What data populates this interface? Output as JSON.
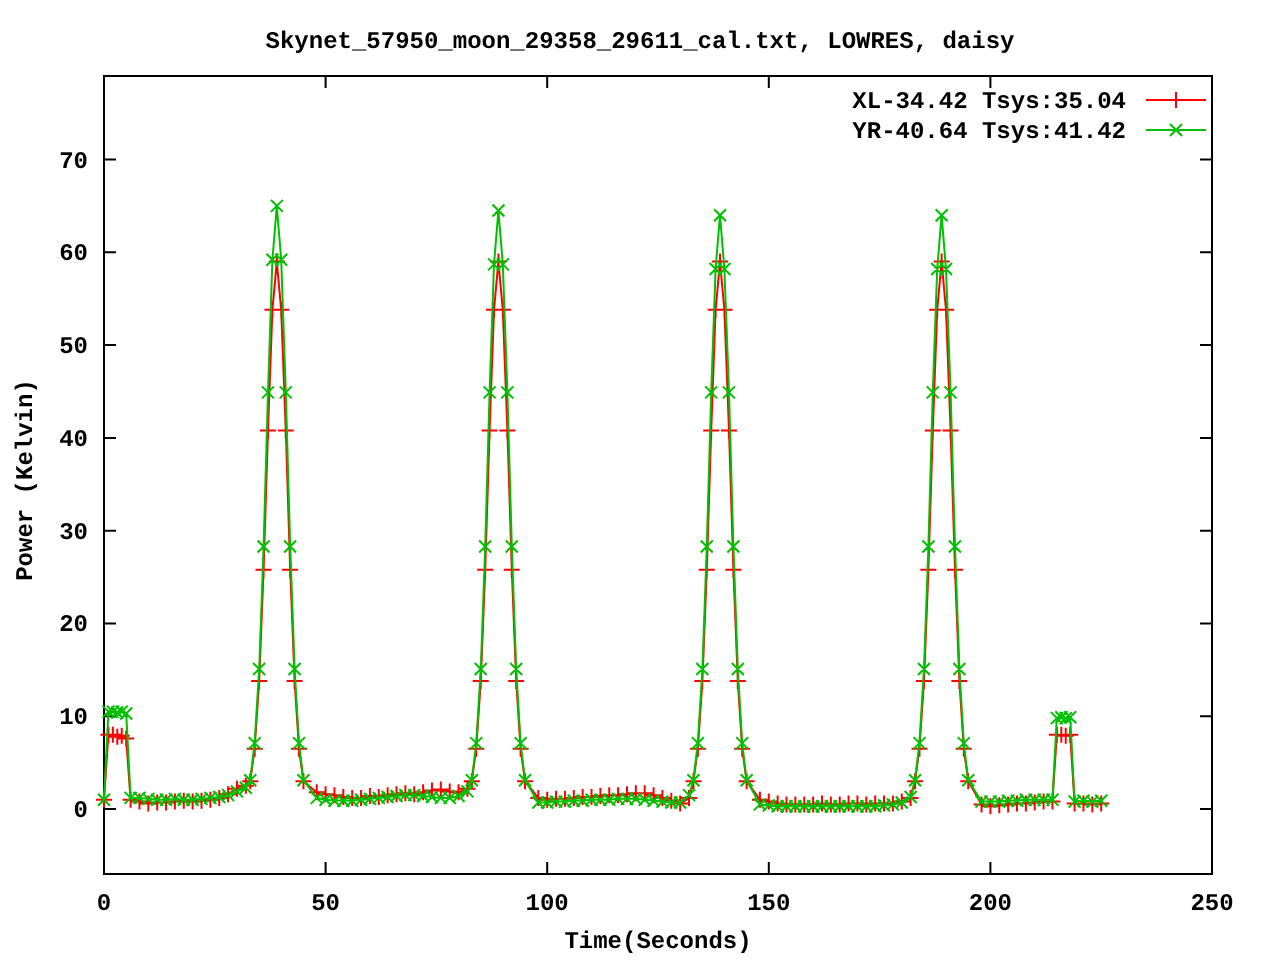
{
  "chart_data": {
    "type": "line",
    "title": "Skynet_57950_moon_29358_29611_cal.txt, LOWRES, daisy",
    "xlabel": "Time(Seconds)",
    "ylabel": "Power (Kelvin)",
    "xlim": [
      0,
      250
    ],
    "ylim": [
      -7,
      79
    ],
    "legend": true,
    "xticks": [
      0,
      50,
      100,
      150,
      200,
      250
    ],
    "yticks": [
      0,
      10,
      20,
      30,
      40,
      50,
      60,
      70
    ],
    "x": [
      0,
      1,
      2,
      3,
      4,
      5,
      6,
      8,
      10,
      12,
      14,
      16,
      18,
      20,
      22,
      24,
      26,
      28,
      30,
      32,
      33,
      34,
      35,
      36,
      37,
      38,
      39,
      40,
      41,
      42,
      43,
      44,
      45,
      48,
      50,
      52,
      54,
      56,
      58,
      60,
      62,
      64,
      66,
      68,
      70,
      72,
      74,
      76,
      78,
      80,
      82,
      83,
      84,
      85,
      86,
      87,
      88,
      89,
      90,
      91,
      92,
      93,
      94,
      95,
      98,
      100,
      102,
      104,
      106,
      108,
      110,
      112,
      114,
      116,
      118,
      120,
      122,
      124,
      126,
      128,
      130,
      132,
      133,
      134,
      135,
      136,
      137,
      138,
      139,
      140,
      141,
      142,
      143,
      144,
      145,
      148,
      150,
      152,
      154,
      156,
      158,
      160,
      162,
      164,
      166,
      168,
      170,
      172,
      174,
      176,
      178,
      180,
      182,
      183,
      184,
      185,
      186,
      187,
      188,
      189,
      190,
      191,
      192,
      193,
      194,
      195,
      198,
      200,
      202,
      204,
      206,
      208,
      210,
      212,
      214,
      215,
      216,
      217,
      218,
      219,
      221,
      223,
      225
    ],
    "series": [
      {
        "name": "XL-34.42 Tsys:35.04",
        "color": "#ff0000",
        "marker": "plus",
        "values": [
          1,
          8,
          8,
          7.8,
          7.9,
          7.6,
          1,
          0.8,
          0.6,
          0.7,
          0.7,
          0.8,
          0.9,
          0.8,
          0.9,
          1,
          1.2,
          1.6,
          2.2,
          2.5,
          3,
          6.5,
          13.8,
          25.8,
          40.8,
          53.8,
          59,
          53.8,
          40.8,
          25.8,
          13.8,
          6.5,
          3,
          1.8,
          1.6,
          1.5,
          1.3,
          1.2,
          1.2,
          1.4,
          1.3,
          1.5,
          1.6,
          1.7,
          1.6,
          1.8,
          2,
          2.1,
          1.9,
          1.8,
          2.2,
          3,
          6.5,
          13.8,
          25.8,
          40.8,
          53.8,
          59,
          53.8,
          40.8,
          25.8,
          13.8,
          6.5,
          3,
          1.2,
          1,
          1.1,
          1.1,
          1.2,
          1.3,
          1.3,
          1.4,
          1.5,
          1.5,
          1.6,
          1.7,
          1.7,
          1.5,
          1.2,
          0.9,
          0.6,
          1.2,
          3,
          6.5,
          13.8,
          25.8,
          40.8,
          53.8,
          59,
          53.8,
          40.8,
          25.8,
          13.8,
          6.5,
          3,
          1,
          0.8,
          0.6,
          0.5,
          0.5,
          0.5,
          0.5,
          0.6,
          0.5,
          0.5,
          0.6,
          0.6,
          0.5,
          0.6,
          0.6,
          0.6,
          0.8,
          1.2,
          3,
          6.5,
          13.8,
          25.8,
          40.8,
          53.8,
          59,
          53.8,
          40.8,
          25.8,
          13.8,
          6.5,
          3,
          0.5,
          0.3,
          0.4,
          0.5,
          0.6,
          0.6,
          0.7,
          0.8,
          0.8,
          8,
          8,
          7.9,
          8,
          0.6,
          0.6,
          0.5,
          0.6
        ]
      },
      {
        "name": "YR-40.64 Tsys:41.42",
        "color": "#00c000",
        "marker": "cross",
        "values": [
          1,
          10.5,
          10.5,
          10.4,
          10.5,
          10.3,
          1.2,
          1.2,
          1.1,
          1,
          1,
          1.1,
          1,
          1,
          1.1,
          1.2,
          1.3,
          1.5,
          1.9,
          2.3,
          3.1,
          7.1,
          15.1,
          28.3,
          44.9,
          59.2,
          65,
          59.2,
          44.9,
          28.3,
          15.1,
          7.1,
          3.1,
          1.2,
          1,
          0.9,
          0.9,
          0.9,
          1,
          1.1,
          1.2,
          1.3,
          1.4,
          1.5,
          1.5,
          1.4,
          1.3,
          1.2,
          1.2,
          1.4,
          1.9,
          3.1,
          7.1,
          15.1,
          28.3,
          44.9,
          58.7,
          64.5,
          58.7,
          44.9,
          28.3,
          15.1,
          7.1,
          3.1,
          0.7,
          0.7,
          0.8,
          0.8,
          0.9,
          0.9,
          1,
          1,
          1,
          1.1,
          1.1,
          1.1,
          1,
          0.9,
          0.8,
          0.7,
          0.7,
          1.5,
          3.1,
          7.1,
          15.1,
          28.3,
          44.9,
          58.2,
          64,
          58.2,
          44.9,
          28.3,
          15.1,
          7.1,
          3.1,
          0.5,
          0.4,
          0.3,
          0.3,
          0.3,
          0.3,
          0.3,
          0.3,
          0.3,
          0.3,
          0.3,
          0.3,
          0.3,
          0.3,
          0.4,
          0.5,
          0.7,
          1.3,
          3.1,
          7.1,
          15.1,
          28.3,
          44.9,
          58.2,
          64,
          58.2,
          44.9,
          28.3,
          15.1,
          7.1,
          3.1,
          0.8,
          0.8,
          0.8,
          0.9,
          0.9,
          1,
          1,
          1,
          1,
          9.8,
          9.9,
          9.8,
          9.9,
          0.8,
          0.9,
          0.8,
          0.9
        ]
      }
    ]
  }
}
